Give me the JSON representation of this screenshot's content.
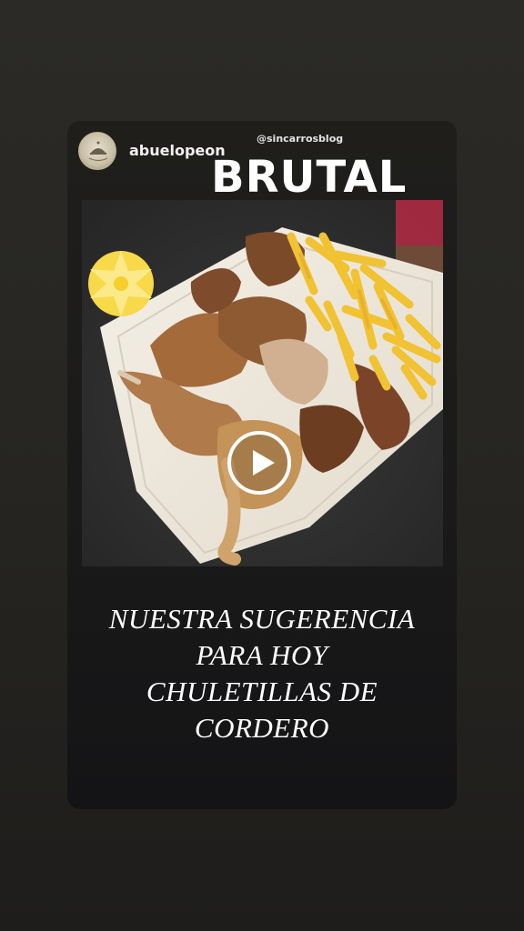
{
  "story": {
    "username": "abuelopeon",
    "headline": "BRUTAL",
    "photo_tag": "@sincarrosblog",
    "avatar_icon": "restaurant-logo-icon",
    "play_icon": "play-icon",
    "caption_lines": [
      "NUESTRA SUGERENCIA",
      "PARA HOY",
      "CHULETILLAS DE",
      "CORDERO"
    ]
  },
  "colors": {
    "background": "#2a2925",
    "card": "#1c1b19",
    "text": "#ffffff"
  }
}
